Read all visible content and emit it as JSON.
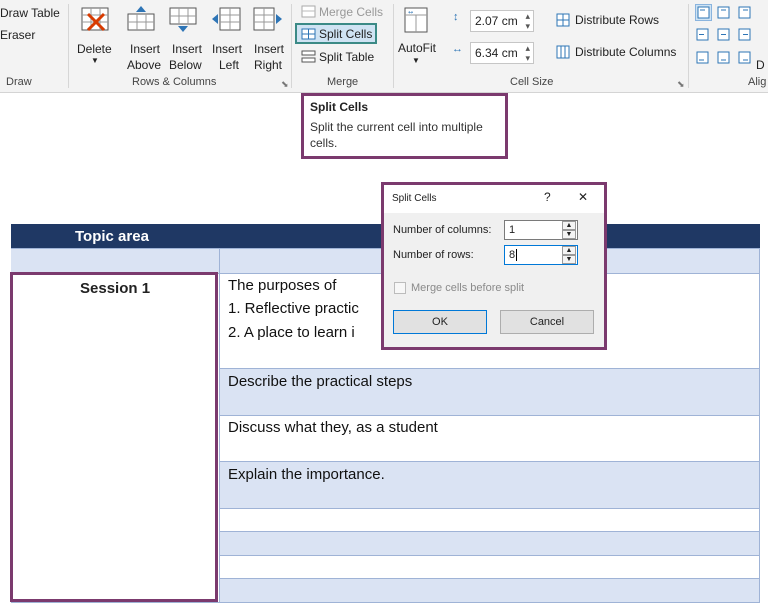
{
  "ribbon": {
    "draw": {
      "draw_table": "Draw Table",
      "eraser": "Eraser",
      "group_label": "Draw"
    },
    "rows_columns": {
      "delete": "Delete",
      "insert_above": [
        "Insert",
        "Above"
      ],
      "insert_below": [
        "Insert",
        "Below"
      ],
      "insert_left": [
        "Insert",
        "Left"
      ],
      "insert_right": [
        "Insert",
        "Right"
      ],
      "group_label": "Rows & Columns"
    },
    "merge": {
      "merge_cells": "Merge Cells",
      "split_cells": "Split Cells",
      "split_table": "Split Table",
      "group_label": "Merge"
    },
    "cell_size": {
      "autofit": "AutoFit",
      "height": "2.07 cm",
      "width": "6.34 cm",
      "distribute_rows": "Distribute Rows",
      "distribute_columns": "Distribute Columns",
      "group_label": "Cell Size"
    },
    "alignment": {
      "group_label_partial": "Alig",
      "cut_letter": "D"
    }
  },
  "tooltip": {
    "title": "Split Cells",
    "body_line1": "Split the current cell into multiple",
    "body_line2": "cells."
  },
  "dialog": {
    "title": "Split Cells",
    "help": "?",
    "close": "✕",
    "columns_label": "Number of columns:",
    "columns_value": "1",
    "rows_label": "Number of rows:",
    "rows_value": "8",
    "merge_before_split": "Merge cells before split",
    "ok": "OK",
    "cancel": "Cancel"
  },
  "document": {
    "header": "Topic area",
    "session": "Session 1",
    "rows": {
      "r1_line1": "The purposes of",
      "r1_line2": "1.  Reflective practic",
      "r1_line3": "2.  A place to learn i",
      "r2": "Describe the practical steps",
      "r3": "Discuss what they, as a student",
      "r4": "Explain the importance."
    }
  },
  "colors": {
    "highlight": "#7b3a6e",
    "split_cells_focus": "#3b8a86",
    "table_header": "#1f3864",
    "table_band": "#dae3f3"
  }
}
